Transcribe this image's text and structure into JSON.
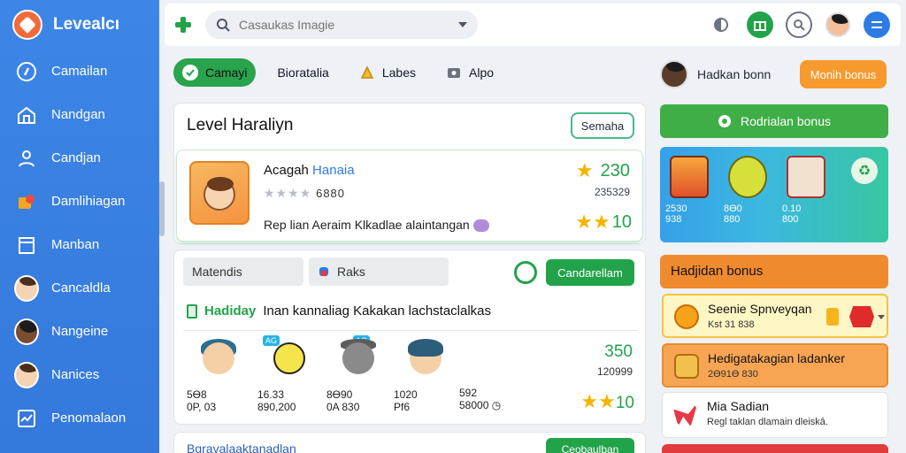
{
  "app": {
    "name": "Levealcı"
  },
  "sidebar": {
    "items": [
      {
        "label": "Camailan",
        "icon": "compass-icon"
      },
      {
        "label": "Nandgan",
        "icon": "home-icon"
      },
      {
        "label": "Candjan",
        "icon": "user-icon"
      },
      {
        "label": "Damlihiagan",
        "icon": "puzzle-icon"
      },
      {
        "label": "Manban",
        "icon": "store-icon"
      },
      {
        "label": "Cancaldla",
        "icon": "avatar"
      },
      {
        "label": "Nangeine",
        "icon": "avatar"
      },
      {
        "label": "Nanices",
        "icon": "avatar"
      },
      {
        "label": "Penomalaon",
        "icon": "chart-icon"
      }
    ]
  },
  "topbar": {
    "search_placeholder": "Casaukas Imagie"
  },
  "filters": [
    {
      "label": "Camayi",
      "active": true
    },
    {
      "label": "Bioratalia",
      "active": false
    },
    {
      "label": "Labes",
      "active": false
    },
    {
      "label": "Alpo",
      "active": false
    }
  ],
  "user": {
    "name": "Hadkan bonn",
    "button": "Monih bonus"
  },
  "level": {
    "title": "Level Haraliyn",
    "outline_button": "Semaha",
    "item": {
      "name_a": "Acagah",
      "name_b": "Hanaia",
      "rating_text": "6880",
      "desc": "Rep lian Aeraim Klkadlae alaintangan",
      "score": "230",
      "sub": "235329",
      "score2": "10"
    }
  },
  "list": {
    "seg1": "Matendis",
    "seg2": "Raks",
    "action_button": "Candarellam",
    "heading_a": "Hadiday",
    "heading_b": "Inan kannaliag Kakakan lachstaclalkas",
    "items": [
      {
        "tag": "",
        "v1": "5Ө8",
        "v2": "0P, 03",
        "style": "b"
      },
      {
        "tag": "AG",
        "v1": "16.33",
        "v2": "890,200",
        "style": "y"
      },
      {
        "tag": "AG",
        "v1": "8Ө90",
        "v2": "0A 830",
        "style": "g"
      },
      {
        "tag": "",
        "v1": "1020",
        "v2": "Pf6",
        "style": "b"
      },
      {
        "tag": "",
        "v1": "592",
        "v2": "58000",
        "style": "none"
      }
    ],
    "score": "350",
    "sub": "120999",
    "star_score": "10"
  },
  "bottom_panel": {
    "title": "Bgravalaaktanadlan",
    "button": "Ceobaulban"
  },
  "right": {
    "green_button": "Rodrialan bonus",
    "gallery": [
      {
        "t1": "2530",
        "t2": "938"
      },
      {
        "t1": "8Ө0",
        "t2": "880"
      },
      {
        "t1": "0.10",
        "t2": "800"
      }
    ],
    "orange_head": "Hadjidan bonus",
    "cards": [
      {
        "title": "Seenie Spnveyqan",
        "sub": "Kst 31 838"
      },
      {
        "title": "Hedigatakagian ladanker",
        "sub": "2Ө91Ө 830"
      },
      {
        "title": "Mia Sadian",
        "sub": "Regl taklan dlamain dleiskâ."
      }
    ]
  },
  "colors": {
    "primary": "#3d86e6",
    "accent": "#22a34a",
    "orange": "#f08a2e"
  }
}
